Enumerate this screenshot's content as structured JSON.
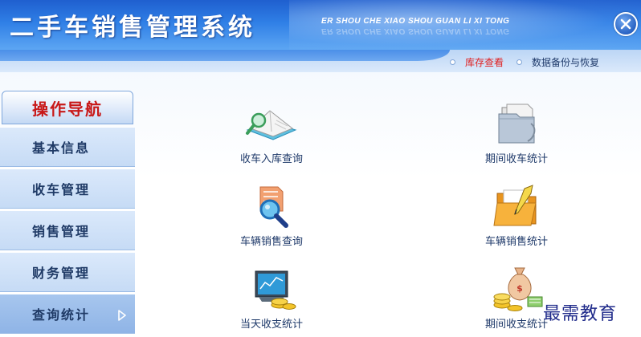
{
  "header": {
    "title": "二手车销售管理系统",
    "subtitle": "ER SHOU CHE XIAO SHOU GUAN LI XI TONG"
  },
  "toolbar": {
    "links": [
      {
        "label": "库存查看",
        "active": true
      },
      {
        "label": "数据备份与恢复",
        "active": false
      }
    ]
  },
  "sidebar": {
    "header": "操作导航",
    "items": [
      {
        "label": "基本信息"
      },
      {
        "label": "收车管理"
      },
      {
        "label": "销售管理"
      },
      {
        "label": "财务管理"
      },
      {
        "label": "查询统计",
        "active": true
      }
    ]
  },
  "functions": [
    {
      "label": "收车入库查询",
      "icon": "book-magnifier-icon"
    },
    {
      "label": "期间收车统计",
      "icon": "folder-documents-icon"
    },
    {
      "label": "车辆销售查询",
      "icon": "magnifier-icon"
    },
    {
      "label": "车辆销售统计",
      "icon": "folder-pencil-icon"
    },
    {
      "label": "当天收支统计",
      "icon": "monitor-coins-icon"
    },
    {
      "label": "期间收支统计",
      "icon": "money-bag-coins-icon"
    }
  ],
  "watermark": "最需教育",
  "colors": {
    "header_blue": "#2f7fe6",
    "nav_header_text": "#c81818",
    "active_link": "#e02020",
    "nav_text": "#1f3a66"
  }
}
